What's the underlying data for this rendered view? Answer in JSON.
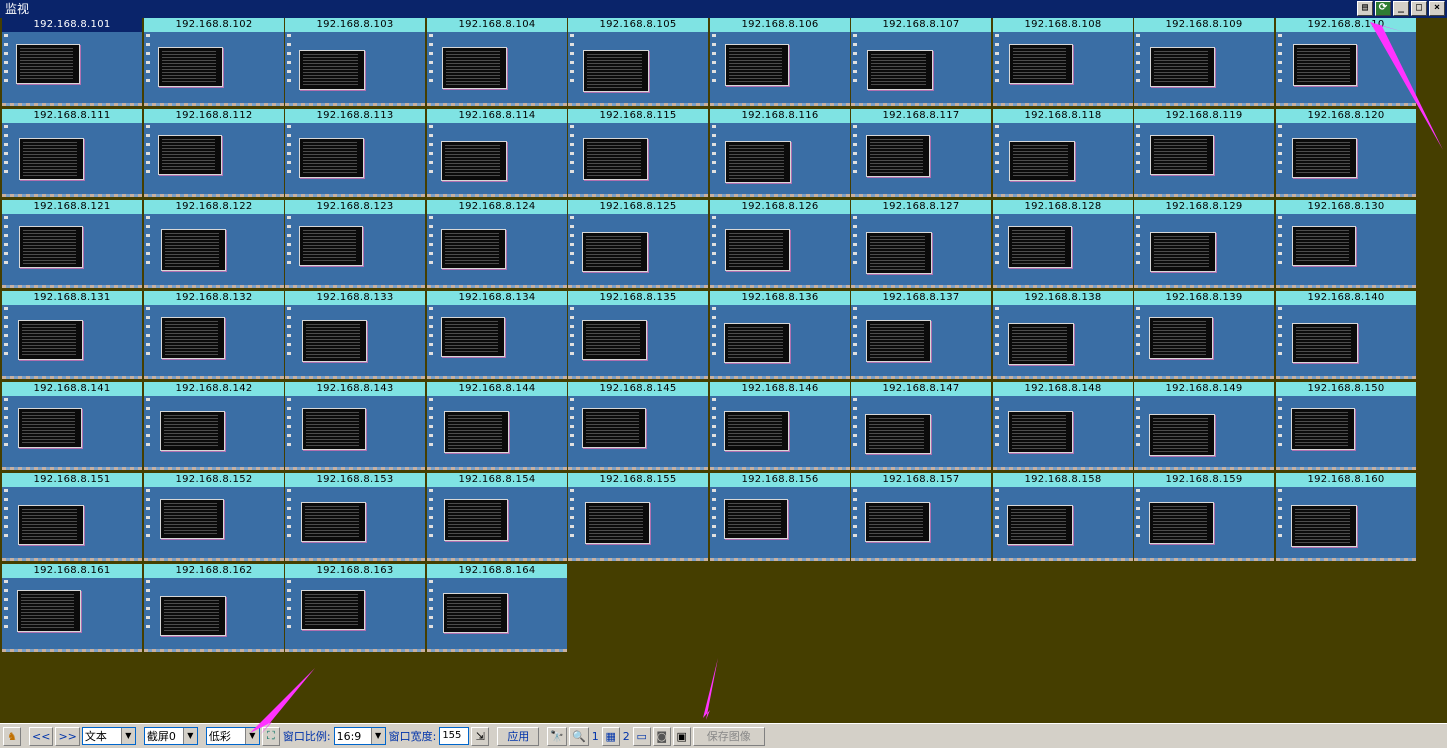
{
  "window": {
    "title": "监视"
  },
  "title_buttons": [
    {
      "name": "list-icon",
      "glyph": "▤"
    },
    {
      "name": "refresh-icon",
      "glyph": "⟳"
    },
    {
      "name": "minimize-icon",
      "glyph": "_"
    },
    {
      "name": "maximize-icon",
      "glyph": "□"
    },
    {
      "name": "close-icon",
      "glyph": "×"
    }
  ],
  "tiles": [
    "192.168.8.101",
    "192.168.8.102",
    "192.168.8.103",
    "192.168.8.104",
    "192.168.8.105",
    "192.168.8.106",
    "192.168.8.107",
    "192.168.8.108",
    "192.168.8.109",
    "192.168.8.110",
    "192.168.8.111",
    "192.168.8.112",
    "192.168.8.113",
    "192.168.8.114",
    "192.168.8.115",
    "192.168.8.116",
    "192.168.8.117",
    "192.168.8.118",
    "192.168.8.119",
    "192.168.8.120",
    "192.168.8.121",
    "192.168.8.122",
    "192.168.8.123",
    "192.168.8.124",
    "192.168.8.125",
    "192.168.8.126",
    "192.168.8.127",
    "192.168.8.128",
    "192.168.8.129",
    "192.168.8.130",
    "192.168.8.131",
    "192.168.8.132",
    "192.168.8.133",
    "192.168.8.134",
    "192.168.8.135",
    "192.168.8.136",
    "192.168.8.137",
    "192.168.8.138",
    "192.168.8.139",
    "192.168.8.140",
    "192.168.8.141",
    "192.168.8.142",
    "192.168.8.143",
    "192.168.8.144",
    "192.168.8.145",
    "192.168.8.146",
    "192.168.8.147",
    "192.168.8.148",
    "192.168.8.149",
    "192.168.8.150",
    "192.168.8.151",
    "192.168.8.152",
    "192.168.8.153",
    "192.168.8.154",
    "192.168.8.155",
    "192.168.8.156",
    "192.168.8.157",
    "192.168.8.158",
    "192.168.8.159",
    "192.168.8.160",
    "192.168.8.161",
    "192.168.8.162",
    "192.168.8.163",
    "192.168.8.164"
  ],
  "selected_tile": "192.168.8.101",
  "toolbar": {
    "prev_label": "<<",
    "next_label": ">>",
    "mode_select": "文本",
    "screen_select": "截屏0",
    "color_select": "低彩",
    "ratio_label": "窗口比例:",
    "ratio_select": "16:9",
    "width_label": "窗口宽度:",
    "width_value": "155",
    "apply_label": "应用",
    "view1_label": "1",
    "view2_label": "2",
    "save_image_label": "保存图像"
  },
  "colors": {
    "accent": "#0a246a",
    "tile_label": "#7fe3e3",
    "desktop": "#3a6ea5",
    "background": "#453e00",
    "annotation": "#ff33ff"
  }
}
